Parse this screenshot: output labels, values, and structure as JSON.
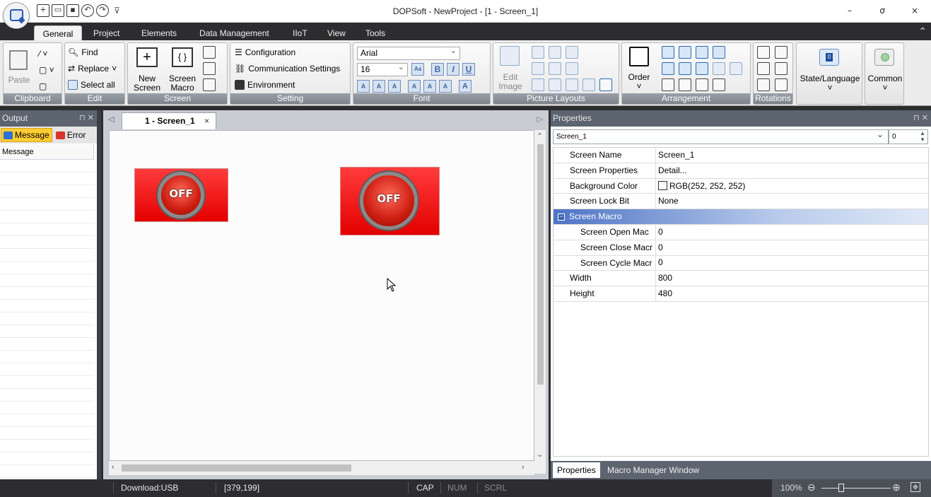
{
  "window": {
    "title": "DOPSoft - NewProject - [1 - Screen_1]",
    "controls": {
      "minimize": "–",
      "restore": "ơ",
      "close": "×"
    },
    "qat_more": "⊽"
  },
  "ribbon_tabs": [
    "General",
    "Project",
    "Elements",
    "Data Management",
    "IIoT",
    "View",
    "Tools"
  ],
  "ribbon": {
    "clipboard": {
      "paste": "Paste",
      "group": "Clipboard"
    },
    "edit": {
      "find": "Find",
      "replace": "Replace",
      "select_all": "Select all",
      "group": "Edit"
    },
    "screen": {
      "new_screen_1": "New",
      "new_screen_2": "Screen",
      "screen_macro_1": "Screen",
      "screen_macro_2": "Macro",
      "group": "Screen"
    },
    "setting": {
      "configuration": "Configuration",
      "communication": "Communication Settings",
      "environment": "Environment",
      "group": "Setting"
    },
    "font": {
      "family": "Arial",
      "size": "16",
      "bold": "B",
      "italic": "I",
      "underline": "U",
      "group": "Font"
    },
    "picture_layouts": {
      "edit_image_1": "Edit",
      "edit_image_2": "Image",
      "group": "Picture Layouts"
    },
    "arrangement": {
      "order": "Order",
      "group": "Arrangement"
    },
    "rotations": {
      "group": "Rotations"
    },
    "state_language": "State/Language",
    "common": "Common"
  },
  "output_panel": {
    "title": "Output",
    "tabs": [
      {
        "label": "Message",
        "color": "#2f6fd6"
      },
      {
        "label": "Error",
        "color": "#d8342c"
      }
    ],
    "column": "Message"
  },
  "editor": {
    "tab_label": "1 - Screen_1",
    "tab_close": "×",
    "buttons": [
      {
        "label": "OFF",
        "name": "off-button-left"
      },
      {
        "label": "OFF",
        "name": "off-button-right"
      }
    ]
  },
  "properties_panel": {
    "title": "Properties",
    "selected_object": "Screen_1",
    "number_value": "0",
    "rows": [
      {
        "key": "Screen Name",
        "value": "Screen_1"
      },
      {
        "key": "Screen Properties",
        "value": "Detail..."
      },
      {
        "key": "Background Color",
        "value": "RGB(252, 252, 252)"
      },
      {
        "key": "Screen Lock Bit",
        "value": "None"
      },
      {
        "key": "Screen Macro",
        "value": ""
      },
      {
        "key": "Screen Open Mac",
        "value": "0"
      },
      {
        "key": "Screen Close Macr",
        "value": "0"
      },
      {
        "key": "Screen Cycle Macr",
        "value": "0"
      },
      {
        "key": "Width",
        "value": "800"
      },
      {
        "key": "Height",
        "value": "480"
      }
    ],
    "footer_tabs": [
      "Properties",
      "Macro Manager Window"
    ]
  },
  "status_bar": {
    "download": "Download:USB",
    "coords": "[379,199]",
    "cap": "CAP",
    "num": "NUM",
    "scrl": "SCRL",
    "zoom": "100%"
  }
}
